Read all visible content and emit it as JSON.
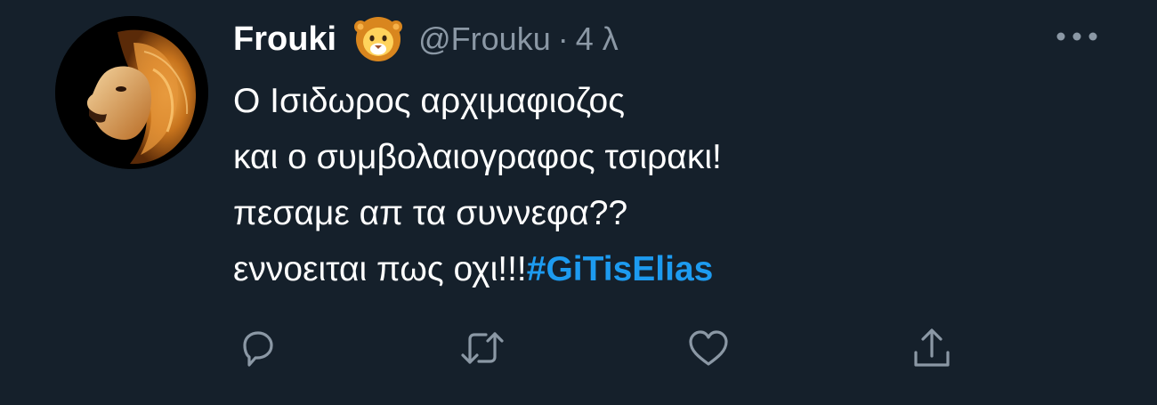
{
  "tweet": {
    "author": {
      "display_name": "Frouki",
      "emoji": "lion-face-emoji",
      "handle": "@Frouku",
      "separator": "·",
      "timestamp": "4 λ",
      "avatar": "lion-profile-photo"
    },
    "text_lines": [
      "Ο Ισιδωρος αρχιμαφιοζος",
      "και ο συμβολαιογραφος τσιρακι!",
      "πεσαμε απ τα συννεφα??",
      "εννοειται πως οχι!!!"
    ],
    "hashtag": "#GiTisElias",
    "actions": {
      "reply_icon": "reply-icon",
      "retweet_icon": "retweet-icon",
      "like_icon": "heart-icon",
      "share_icon": "share-icon"
    },
    "more_icon": "more-dots-icon"
  },
  "colors": {
    "background": "#15202b",
    "text": "#ffffff",
    "secondary_text": "#8b98a5",
    "hashtag": "#1d9bf0"
  }
}
